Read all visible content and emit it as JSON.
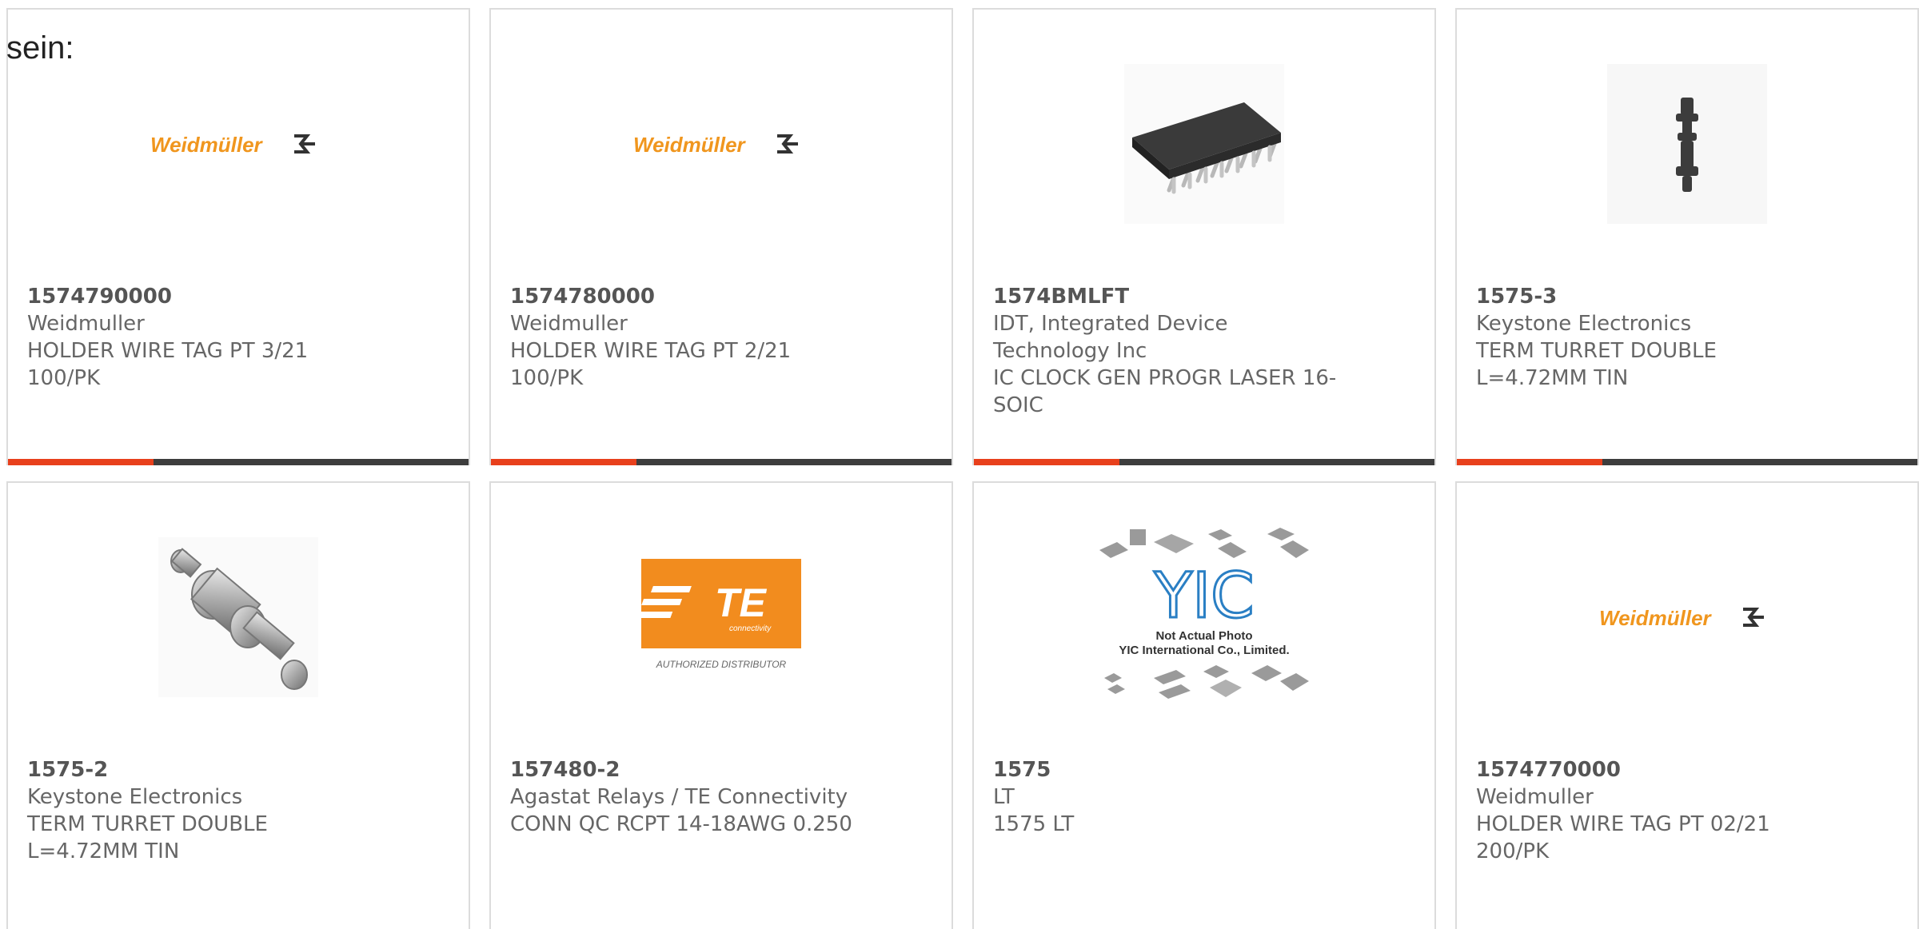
{
  "intro_text": "sein:",
  "colors": {
    "accent": "#e8401c",
    "bar": "#3d3d3d",
    "weidmuller_orange": "#f0961e",
    "te_orange": "#f28c1e",
    "yic_blue": "#2a7fc4"
  },
  "products": [
    {
      "part_number": "1574790000",
      "manufacturer": "Weidmuller",
      "description": "HOLDER WIRE TAG PT 3/21 100/PK",
      "image": "weidmuller-logo",
      "logo_text": "Weidmüller"
    },
    {
      "part_number": "1574780000",
      "manufacturer": "Weidmuller",
      "description": "HOLDER WIRE TAG PT 2/21 100/PK",
      "image": "weidmuller-logo",
      "logo_text": "Weidmüller"
    },
    {
      "part_number": "1574BMLFT",
      "manufacturer": "IDT, Integrated Device Technology Inc",
      "description": "IC CLOCK GEN PROGR LASER 16-SOIC",
      "image": "soic-chip-photo"
    },
    {
      "part_number": "1575-3",
      "manufacturer": "Keystone Electronics",
      "description": "TERM TURRET DOUBLE L=4.72MM TIN",
      "image": "turret-terminal-photo"
    },
    {
      "part_number": "1575-2",
      "manufacturer": "Keystone Electronics",
      "description": "TERM TURRET DOUBLE L=4.72MM TIN",
      "image": "turret-terminal-photo"
    },
    {
      "part_number": "157480-2",
      "manufacturer": "Agastat Relays / TE Connectivity",
      "description": "CONN QC RCPT 14-18AWG 0.250",
      "image": "te-connectivity-logo",
      "logo_text": "TE",
      "logo_subtext": "connectivity",
      "logo_caption": "AUTHORIZED DISTRIBUTOR"
    },
    {
      "part_number": "1575",
      "manufacturer": "LT",
      "description": "1575 LT",
      "image": "yic-placeholder",
      "logo_text": "YIC",
      "caption_line1": "Not Actual Photo",
      "caption_line2": "YIC International Co., Limited."
    },
    {
      "part_number": "1574770000",
      "manufacturer": "Weidmuller",
      "description": "HOLDER WIRE TAG PT 02/21 200/PK",
      "image": "weidmuller-logo",
      "logo_text": "Weidmüller"
    }
  ]
}
